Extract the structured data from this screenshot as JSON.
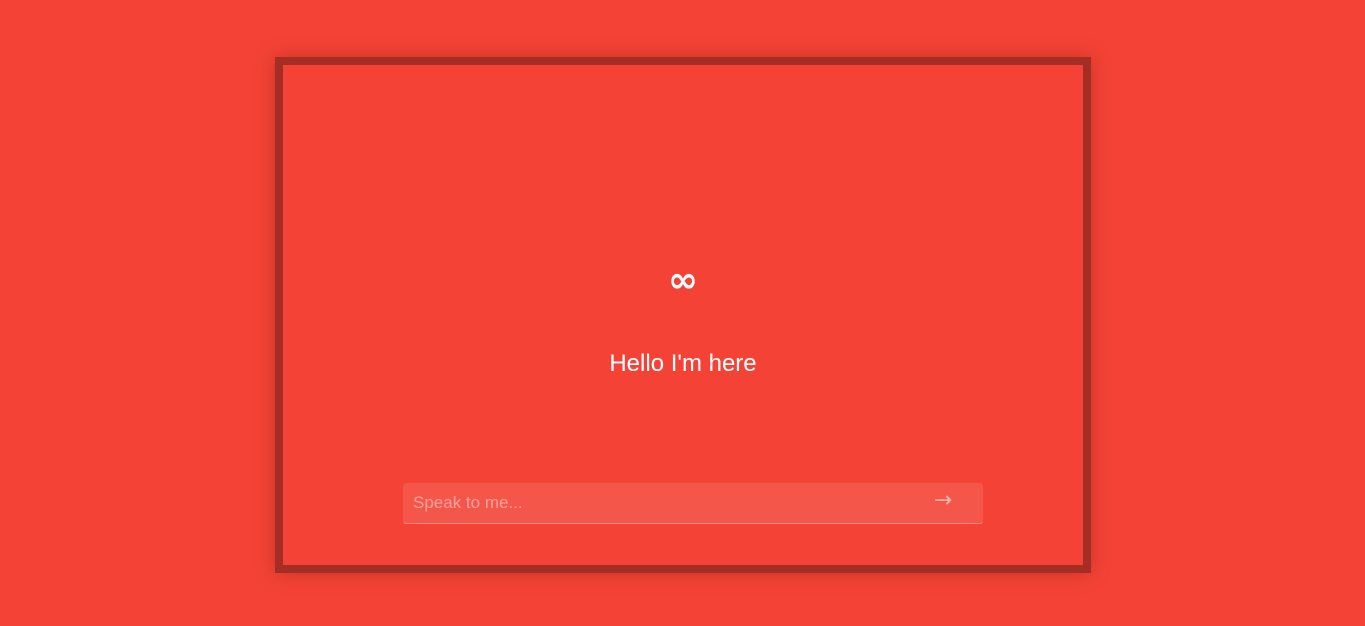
{
  "chat": {
    "logo_glyph": "∞",
    "greeting": "Hello I'm here",
    "input": {
      "value": "",
      "placeholder": "Speak to me..."
    },
    "send_glyph": "→"
  },
  "colors": {
    "background": "#f44336",
    "frame_border": "#a42d24",
    "input_background": "#f5564a",
    "text": "#ffffff"
  }
}
